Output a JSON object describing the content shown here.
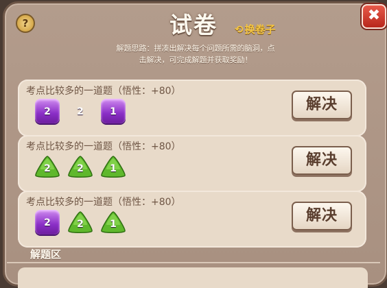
{
  "header": {
    "title": "试卷",
    "help_label": "?",
    "swap_icon": "refresh-icon",
    "swap_icon_glyph": "⟲",
    "swap_label": "换卷子",
    "close_label": "✖"
  },
  "hint": {
    "line1": "解题思路：拼凑出解决每个问题所需的脑洞，点",
    "line2": "击解决，可完成解题并获取奖励！"
  },
  "colors": {
    "gem_purple": "#8a2ec6",
    "gem_gold": "#e6a81e",
    "gem_green": "#5fb82c",
    "close_red": "#c8342a"
  },
  "tasks": [
    {
      "title": "考点比较多的一道题（悟性：+80）",
      "button": "解决",
      "gems": [
        {
          "shape": "square",
          "color": "purple",
          "value": "2"
        },
        {
          "shape": "diamond",
          "color": "gold",
          "value": "2"
        },
        {
          "shape": "square",
          "color": "purple",
          "value": "1"
        }
      ]
    },
    {
      "title": "考点比较多的一道题（悟性：+80）",
      "button": "解决",
      "gems": [
        {
          "shape": "triangle",
          "color": "green",
          "value": "2"
        },
        {
          "shape": "triangle",
          "color": "green",
          "value": "2"
        },
        {
          "shape": "triangle",
          "color": "green",
          "value": "1"
        }
      ]
    },
    {
      "title": "考点比较多的一道题（悟性：+80）",
      "button": "解决",
      "gems": [
        {
          "shape": "square",
          "color": "purple",
          "value": "2"
        },
        {
          "shape": "triangle",
          "color": "green",
          "value": "2"
        },
        {
          "shape": "triangle",
          "color": "green",
          "value": "1"
        }
      ]
    }
  ],
  "answer_section": {
    "label": "解题区"
  }
}
